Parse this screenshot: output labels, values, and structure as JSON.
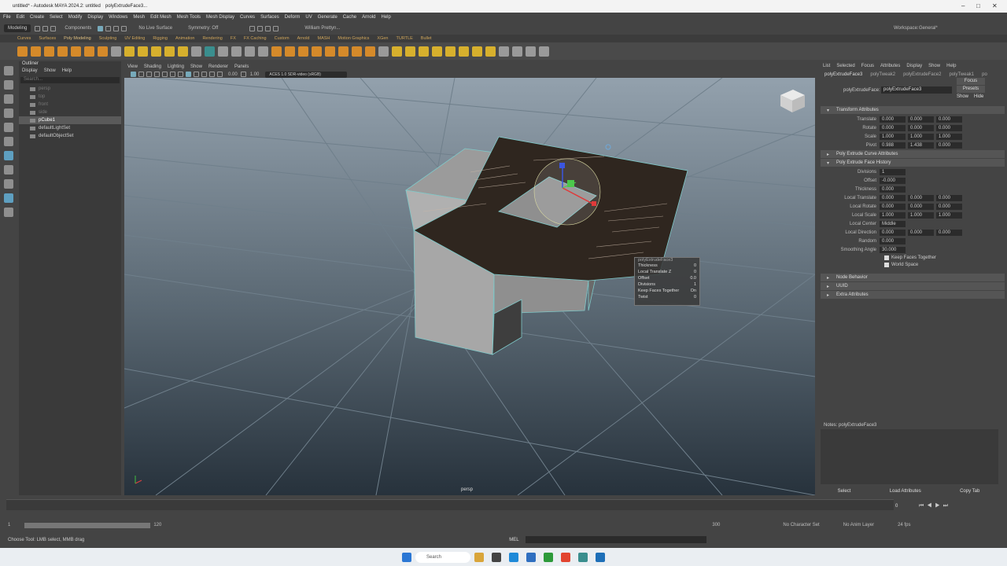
{
  "window": {
    "title": "untitled* - Autodesk MAYA 2024.2: untitled",
    "node_label": "polyExtrudeFace3..."
  },
  "menubar": [
    "File",
    "Edit",
    "Create",
    "Select",
    "Modify",
    "Display",
    "Windows",
    "Mesh",
    "Edit Mesh",
    "Mesh Tools",
    "Mesh Display",
    "Curves",
    "Surfaces",
    "Deform",
    "UV",
    "Generate",
    "Cache",
    "Arnold",
    "Help"
  ],
  "workspace": {
    "label": "Workspace:",
    "value": "General*"
  },
  "statusline": {
    "mode": "Modeling",
    "components": "Components",
    "live_surface": "No Live Surface",
    "symmetry": "Symmetry: Off",
    "user": "William Prettyn..."
  },
  "shelf_tabs": [
    "Curves",
    "Surfaces",
    "Poly Modeling",
    "Sculpting",
    "UV Editing",
    "Rigging",
    "Animation",
    "Rendering",
    "FX",
    "FX Caching",
    "Custom",
    "Arnold",
    "MASH",
    "Motion Graphics",
    "XGen",
    "TURTLE",
    "Bullet"
  ],
  "shelf_active": "Poly Modeling",
  "outliner": {
    "title": "Outliner",
    "menu": [
      "Display",
      "Show",
      "Help"
    ],
    "search_placeholder": "Search...",
    "items": [
      {
        "label": "persp",
        "dim": true
      },
      {
        "label": "top",
        "dim": true
      },
      {
        "label": "front",
        "dim": true
      },
      {
        "label": "side",
        "dim": true
      },
      {
        "label": "pCube1",
        "selected": true
      },
      {
        "label": "defaultLightSet"
      },
      {
        "label": "defaultObjectSet"
      }
    ]
  },
  "viewport": {
    "menu": [
      "View",
      "Shading",
      "Lighting",
      "Show",
      "Renderer",
      "Panels"
    ],
    "exposure": "0.00",
    "gamma": "1.00",
    "colorspace": "ACES 1.0 SDR-video (sRGB)",
    "camera_label": "persp"
  },
  "popup": {
    "title": "polyExtrudeFace3",
    "rows": [
      {
        "label": "Thickness",
        "value": "0"
      },
      {
        "label": "Local Translate Z",
        "value": "0"
      },
      {
        "label": "Offset",
        "value": "0.0"
      },
      {
        "label": "Divisions",
        "value": "1"
      },
      {
        "label": "Keep Faces Together",
        "value": "On"
      },
      {
        "label": "Twist",
        "value": "0"
      }
    ]
  },
  "attr": {
    "menu": [
      "List",
      "Selected",
      "Focus",
      "Attributes",
      "Display",
      "Show",
      "Help"
    ],
    "tabs": [
      "polyExtrudeFace3",
      "polyTweak2",
      "polyExtrudeFace2",
      "polyTweak1",
      "po"
    ],
    "node_label": "polyExtrudeFace:",
    "node_value": "polyExtrudeFace3",
    "buttons": {
      "focus": "Focus",
      "presets": "Presets",
      "show": "Show",
      "hide": "Hide"
    },
    "transform": {
      "title": "Transform Attributes",
      "rows": [
        {
          "label": "Translate",
          "values": [
            "0.000",
            "0.000",
            "0.000"
          ]
        },
        {
          "label": "Rotate",
          "values": [
            "0.000",
            "0.000",
            "0.000"
          ]
        },
        {
          "label": "Scale",
          "values": [
            "1.000",
            "1.000",
            "1.000"
          ]
        },
        {
          "label": "Pivot",
          "values": [
            "0.988",
            "1.438",
            "0.000"
          ]
        }
      ]
    },
    "curve_section": "Poly Extrude Curve Attributes",
    "history": {
      "title": "Poly Extrude Face History",
      "rows": [
        {
          "label": "Divisions",
          "values": [
            "1"
          ]
        },
        {
          "label": "Offset",
          "values": [
            "-0.000"
          ]
        },
        {
          "label": "Thickness",
          "values": [
            "0.000"
          ]
        },
        {
          "label": "Local Translate",
          "values": [
            "0.000",
            "0.000",
            "0.000"
          ]
        },
        {
          "label": "Local Rotate",
          "values": [
            "0.000",
            "0.000",
            "0.000"
          ]
        },
        {
          "label": "Local Scale",
          "values": [
            "1.000",
            "1.000",
            "1.000"
          ]
        },
        {
          "label": "Local Center",
          "values": [
            "Middle"
          ]
        },
        {
          "label": "Local Direction",
          "values": [
            "0.000",
            "0.000",
            "0.000"
          ]
        },
        {
          "label": "Random",
          "values": [
            "0.000"
          ]
        },
        {
          "label": "Smoothing Angle",
          "values": [
            "30.000"
          ]
        }
      ],
      "checks": [
        "Keep Faces Together",
        "World Space"
      ]
    },
    "extra_sections": [
      "Node Behavior",
      "UUID",
      "Extra Attributes"
    ],
    "notes_label": "Notes: polyExtrudeFace3",
    "bottom_buttons": [
      "Select",
      "Load Attributes",
      "Copy Tab"
    ]
  },
  "timeline": {
    "start": "1",
    "end": "120",
    "current": "0",
    "range_end": "300",
    "range_mid": "120",
    "char_set": "No Character Set",
    "anim_layer": "No Anim Layer",
    "fps": "24 fps"
  },
  "helpline": {
    "mel": "MEL",
    "text": "Choose Tool: LMB select, MMB drag"
  },
  "taskbar": {
    "search": "Search"
  }
}
